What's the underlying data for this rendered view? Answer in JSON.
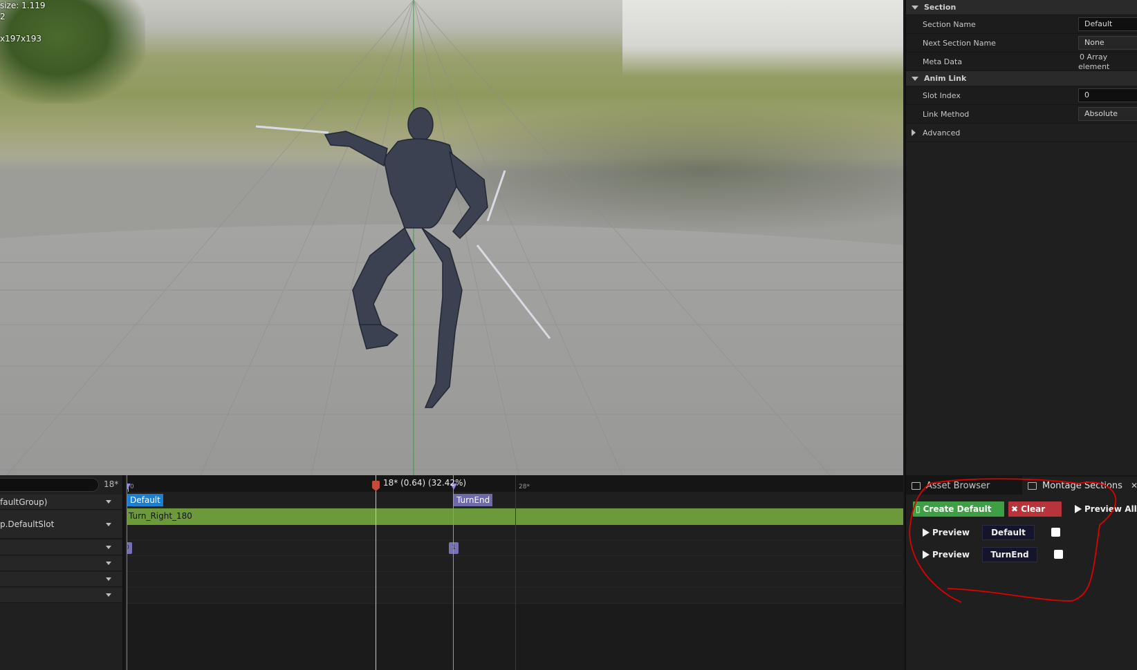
{
  "viewport": {
    "stats": [
      "size: 1.119",
      "2",
      "",
      "x197x193"
    ]
  },
  "details": {
    "section_category": "Section",
    "section_name_label": "Section Name",
    "section_name_value": "Default",
    "next_section_label": "Next Section Name",
    "next_section_value": "None",
    "meta_data_label": "Meta Data",
    "meta_data_value": "0 Array element",
    "anim_link_category": "Anim Link",
    "slot_index_label": "Slot Index",
    "slot_index_value": "0",
    "link_method_label": "Link Method",
    "link_method_value": "Absolute",
    "advanced_category": "Advanced"
  },
  "timeline": {
    "frame_count_label": "18*",
    "ruler": {
      "start_label": "0",
      "mid_label": "28*"
    },
    "playhead_label": "18* (0.64) (32.42%)",
    "tracks": [
      {
        "label": "faultGroup)"
      },
      {
        "label": "p.DefaultSlot"
      },
      {
        "label": ""
      },
      {
        "label": ""
      },
      {
        "label": ""
      },
      {
        "label": ""
      }
    ],
    "sections": [
      {
        "name": "Default",
        "color": "#1f7fcf"
      },
      {
        "name": "TurnEnd",
        "color": "#6e6aa8"
      }
    ],
    "anim_segment": "Turn_Right_180",
    "notifies": [
      "0",
      "1"
    ]
  },
  "montage": {
    "tabs": [
      {
        "label": "Asset Browser",
        "active": false
      },
      {
        "label": "Montage Sections",
        "active": true
      }
    ],
    "create_default_label": "Create Default",
    "clear_label": "Clear",
    "preview_all_label": "Preview All",
    "rows": [
      {
        "preview_label": "Preview",
        "section": "Default"
      },
      {
        "preview_label": "Preview",
        "section": "TurnEnd"
      }
    ]
  },
  "colors": {
    "accent_green": "#3f9f44",
    "accent_red": "#b8343a",
    "anim_bar": "#6c9a3a",
    "playhead": "#c34b39",
    "annotation": "#e00000"
  }
}
